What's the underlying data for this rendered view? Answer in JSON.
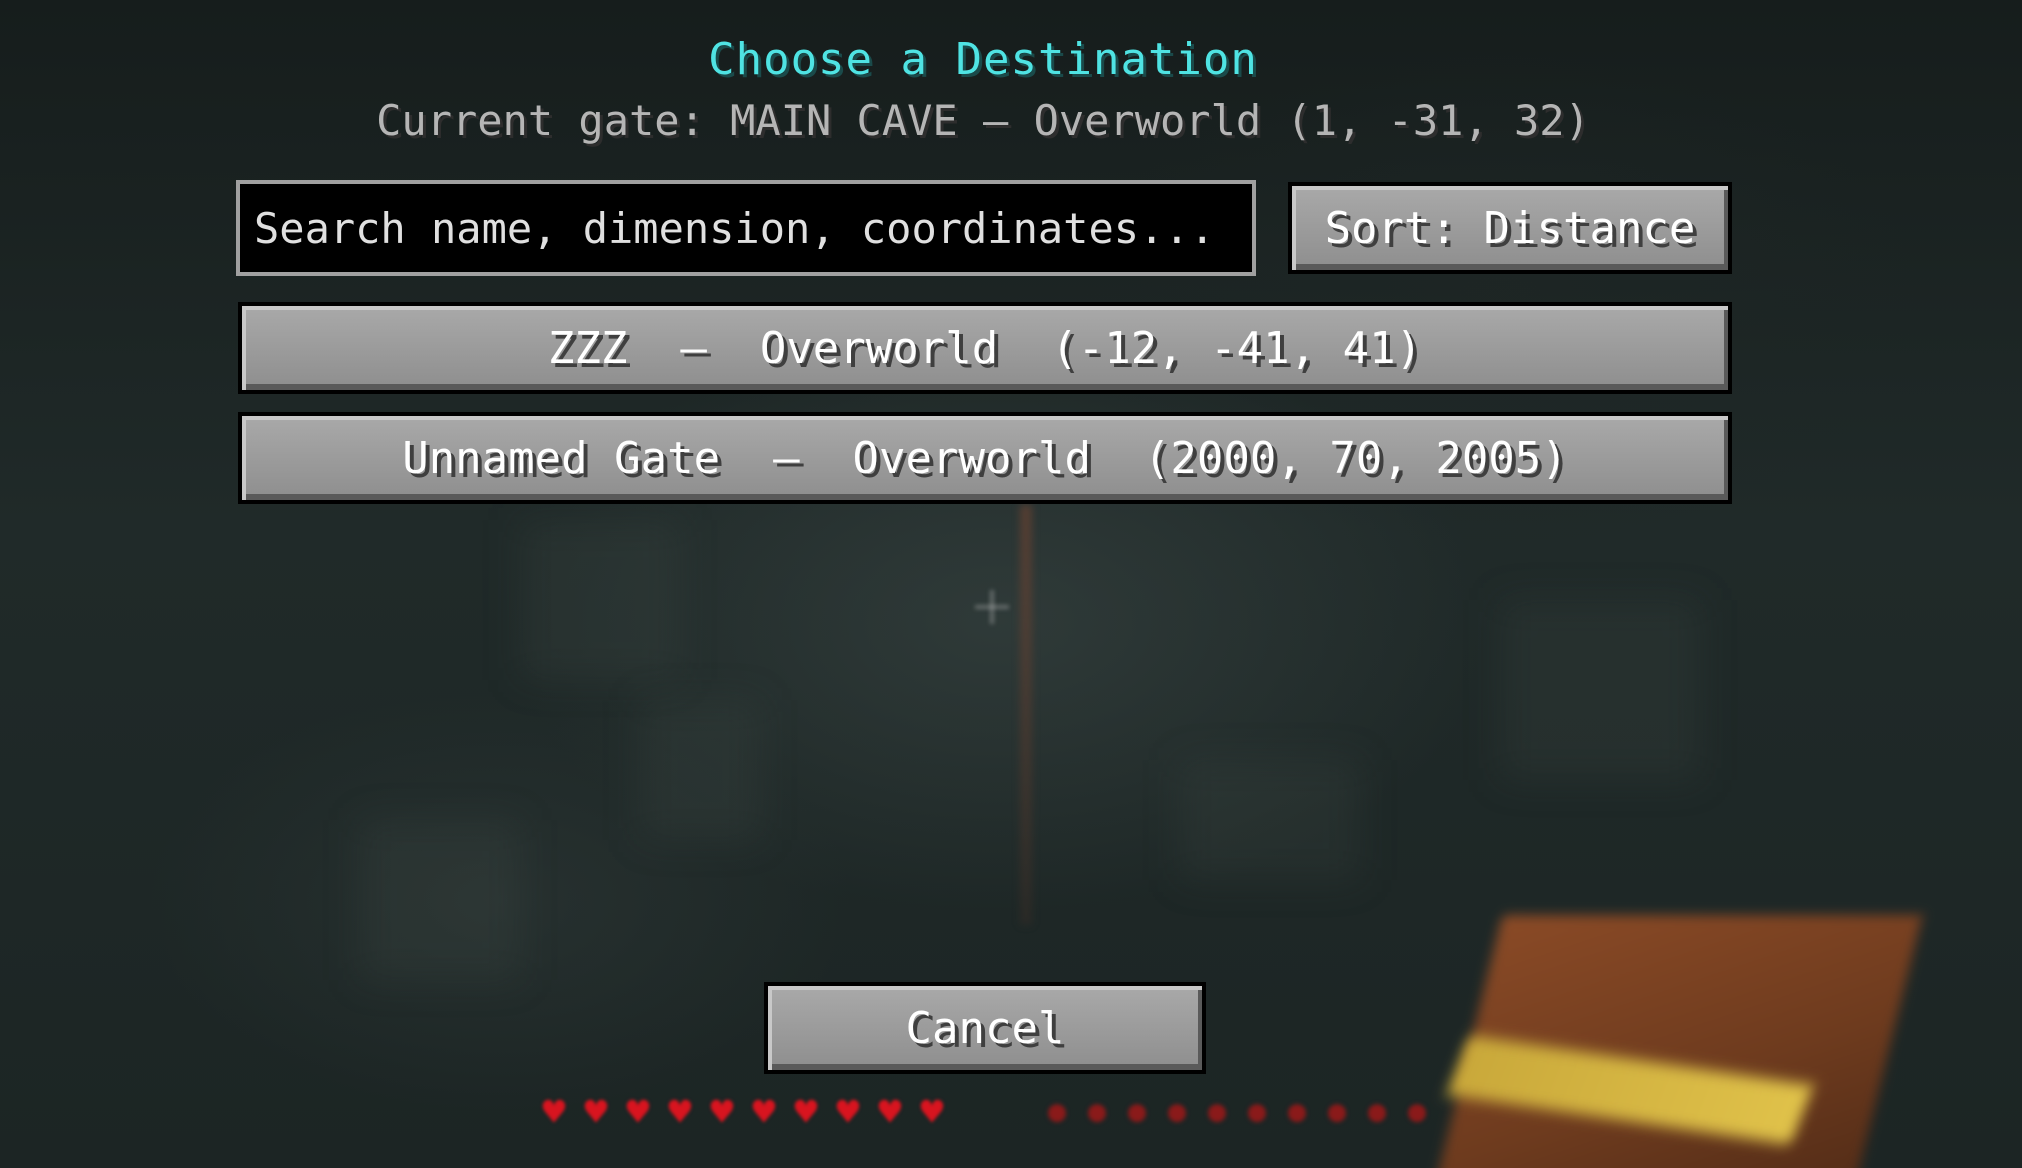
{
  "screen": {
    "title": "Choose a Destination",
    "current_gate": "Current gate: MAIN CAVE — Overworld (1, -31, 32)"
  },
  "search": {
    "placeholder": "Search name, dimension, coordinates...",
    "value": ""
  },
  "sort": {
    "label": "Sort: Distance"
  },
  "destinations": [
    {
      "label": "ZZZ  —  Overworld  (-12, -41, 41)"
    },
    {
      "label": "Unnamed Gate  —  Overworld  (2000, 70, 2005)"
    }
  ],
  "footer": {
    "cancel_label": "Cancel"
  },
  "hud": {
    "hearts_icon": "heart-icon",
    "armor_icon": "hunger-icon",
    "colors": {
      "title": "#4fe3e3",
      "subtitle": "#b5b5b5",
      "heart": "#d8141f"
    }
  }
}
